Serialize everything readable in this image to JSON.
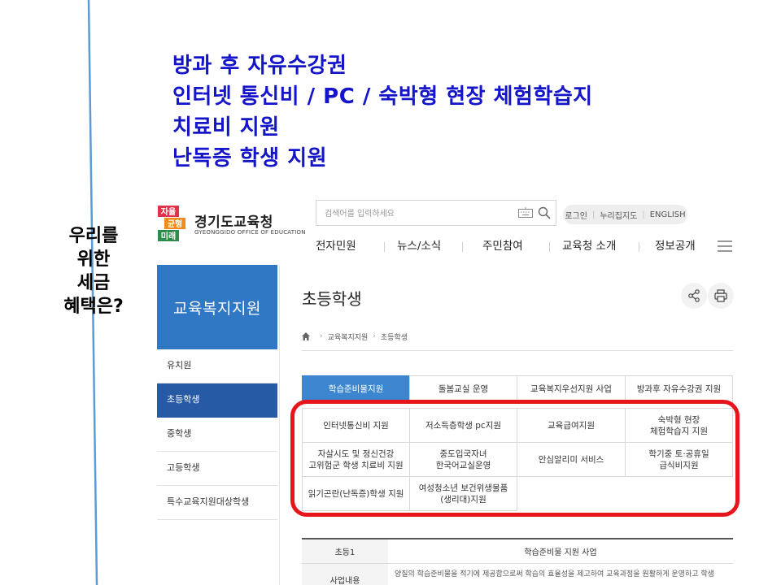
{
  "slide": {
    "headline_lines": [
      "방과 후 자유수강권",
      "인터넷 통신비 / PC / 숙박형 현장 체험학습지",
      "치료비 지원",
      "난독증 학생 지원"
    ],
    "side_question_lines": [
      "우리를",
      "위한",
      "세금",
      "혜택은?"
    ],
    "colors": {
      "headline": "#1414c8",
      "highlight_box": "#e8141b",
      "vertical_line": "#5b9bd5"
    }
  },
  "site": {
    "logo": {
      "mark_text": [
        "자율",
        "균형",
        "미래"
      ],
      "title": "경기도교육청",
      "subtitle": "GYEONGGIDO OFFICE OF EDUCATION"
    },
    "search": {
      "placeholder": "검색어를 입력하세요",
      "icons": [
        "keyboard-icon",
        "search-icon"
      ]
    },
    "util_links": [
      "로그인",
      "누리집지도",
      "ENGLISH"
    ],
    "gnb": [
      "전자민원",
      "뉴스/소식",
      "주민참여",
      "교육청 소개",
      "정보공개"
    ],
    "lnb": {
      "title": "교육복지지원",
      "items": [
        {
          "label": "유치원",
          "active": false
        },
        {
          "label": "초등학생",
          "active": true
        },
        {
          "label": "중학생",
          "active": false
        },
        {
          "label": "고등학생",
          "active": false
        },
        {
          "label": "특수교육지원대상학생",
          "active": false
        }
      ]
    },
    "page_title": "초등학생",
    "breadcrumb": [
      "교육복지지원",
      "초등학생"
    ],
    "tabs": [
      [
        "학습준비물지원",
        "돌봄교실 운영",
        "교육복지우선지원 사업",
        "방과후 자유수강권 지원"
      ],
      [
        "인터넷통신비 지원",
        "저소득층학생 pc지원",
        "교육급여지원",
        "숙박형 현장\n체험학습지 지원"
      ],
      [
        "자살시도 및 정신건강\n고위험군 학생 치료비 지원",
        "중도입국자녀\n한국어교실운영",
        "안심알리미 서비스",
        "학기중 토·공휴일\n급식비지원"
      ],
      [
        "읽기곤란(난독증)학생 지원",
        "여성청소년 보건위생물품\n(생리대)지원"
      ]
    ],
    "active_tab": "학습준비물지원",
    "info_table": {
      "rows": [
        {
          "th": "초등1",
          "td": "학습준비물 지원 사업"
        },
        {
          "th": "사업내용",
          "td": "양질의 학습준비물을 적기에 제공함으로써 학습의 효율성을 제고하여 교육과정을 원활하게 운영하고 학생"
        }
      ]
    }
  }
}
